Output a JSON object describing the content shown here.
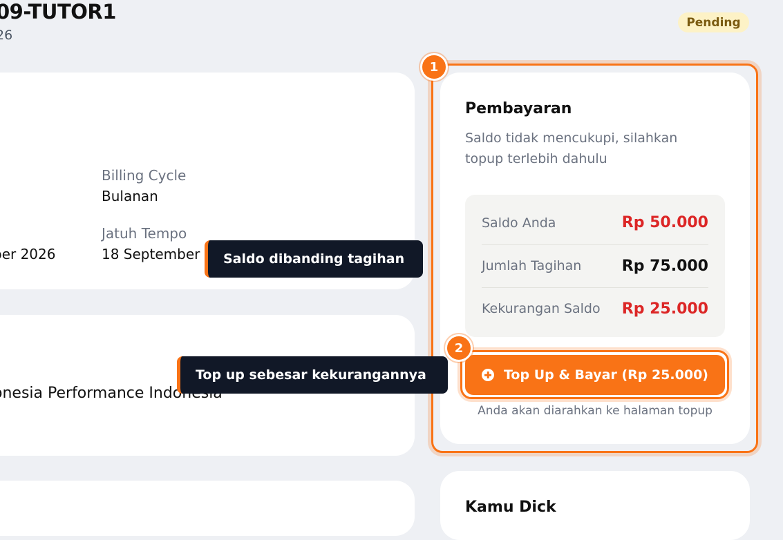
{
  "header": {
    "title": "09-TUTOR1",
    "subtitle": "26",
    "status": "Pending"
  },
  "details": {
    "billing_cycle_label": "Billing Cycle",
    "billing_cycle_value": "Bulanan",
    "due_label": "Jatuh Tempo",
    "due_value": "18 September 2",
    "left_date_value": "ber 2026"
  },
  "company": {
    "name": "onesia Performance Indonesia"
  },
  "payment": {
    "title": "Pembayaran",
    "description": "Saldo tidak mencukupi, silahkan topup terlebih dahulu",
    "summary": [
      {
        "label": "Saldo Anda",
        "amount": "Rp 50.000",
        "color": "#dc2626"
      },
      {
        "label": "Jumlah Tagihan",
        "amount": "Rp 75.000",
        "color": "#111111"
      },
      {
        "label": "Kekurangan Saldo",
        "amount": "Rp 25.000",
        "color": "#dc2626"
      }
    ],
    "button_label": "Top Up & Bayar (Rp 25.000)",
    "redirect_note": "Anda akan diarahkan ke halaman topup"
  },
  "guide": {
    "step1": "1",
    "step2": "2",
    "tooltip1": "Saldo dibanding tagihan",
    "tooltip2": "Top up sebesar kekurangannya"
  },
  "next_card": {
    "title": "Kamu Dick"
  },
  "colors": {
    "accent": "#f97316",
    "danger": "#dc2626",
    "badge_bg": "#fdf2c6",
    "tooltip_bg": "#111827"
  }
}
